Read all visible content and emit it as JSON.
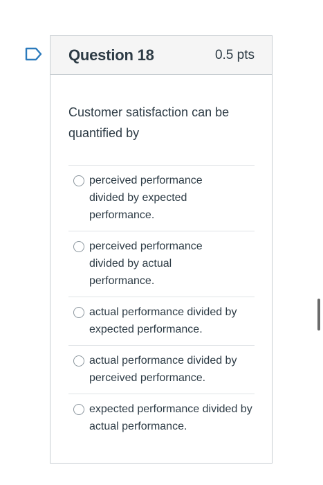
{
  "question": {
    "title": "Question 18",
    "points": "0.5 pts",
    "text": "Customer satisfaction can be quantified by"
  },
  "answers": [
    {
      "label": "perceived performance divided by expected performance."
    },
    {
      "label": "perceived performance divided by actual performance."
    },
    {
      "label": "actual performance divided by expected performance."
    },
    {
      "label": "actual performance divided by perceived performance."
    },
    {
      "label": "expected performance divided by actual performance."
    }
  ],
  "colors": {
    "flag_accent": "#2b7abc",
    "text": "#2d3b45",
    "header_bg": "#f5f5f5",
    "border": "#c7cdd1"
  },
  "icons": {
    "flag": "bookmark-flag-icon",
    "radio": "radio-empty-icon"
  }
}
